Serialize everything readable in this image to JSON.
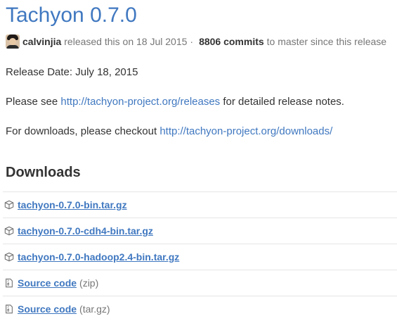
{
  "release": {
    "title": "Tachyon 0.7.0",
    "author": "calvinjia",
    "released_text": "released this on 18 Jul 2015",
    "separator": "·",
    "commits_count": "8806 commits",
    "commits_suffix": "to master since this release"
  },
  "notes": {
    "release_date": "Release Date: July 18, 2015",
    "see_prefix": "Please see",
    "see_link": "http://tachyon-project.org/releases",
    "see_suffix": "for detailed release notes.",
    "downloads_prefix": "For downloads, please checkout",
    "downloads_link": "http://tachyon-project.org/downloads/"
  },
  "downloads": {
    "heading": "Downloads",
    "items": [
      {
        "name": "tachyon-0.7.0-bin.tar.gz",
        "suffix": "",
        "icon": "package-icon"
      },
      {
        "name": "tachyon-0.7.0-cdh4-bin.tar.gz",
        "suffix": "",
        "icon": "package-icon"
      },
      {
        "name": "tachyon-0.7.0-hadoop2.4-bin.tar.gz",
        "suffix": "",
        "icon": "package-icon"
      },
      {
        "name": "Source code",
        "suffix": "(zip)",
        "icon": "file-zip-icon"
      },
      {
        "name": "Source code",
        "suffix": "(tar.gz)",
        "icon": "file-zip-icon"
      }
    ]
  },
  "colors": {
    "link": "#4078c0",
    "text": "#333333",
    "muted": "#767676",
    "border": "#e5e5e5"
  }
}
